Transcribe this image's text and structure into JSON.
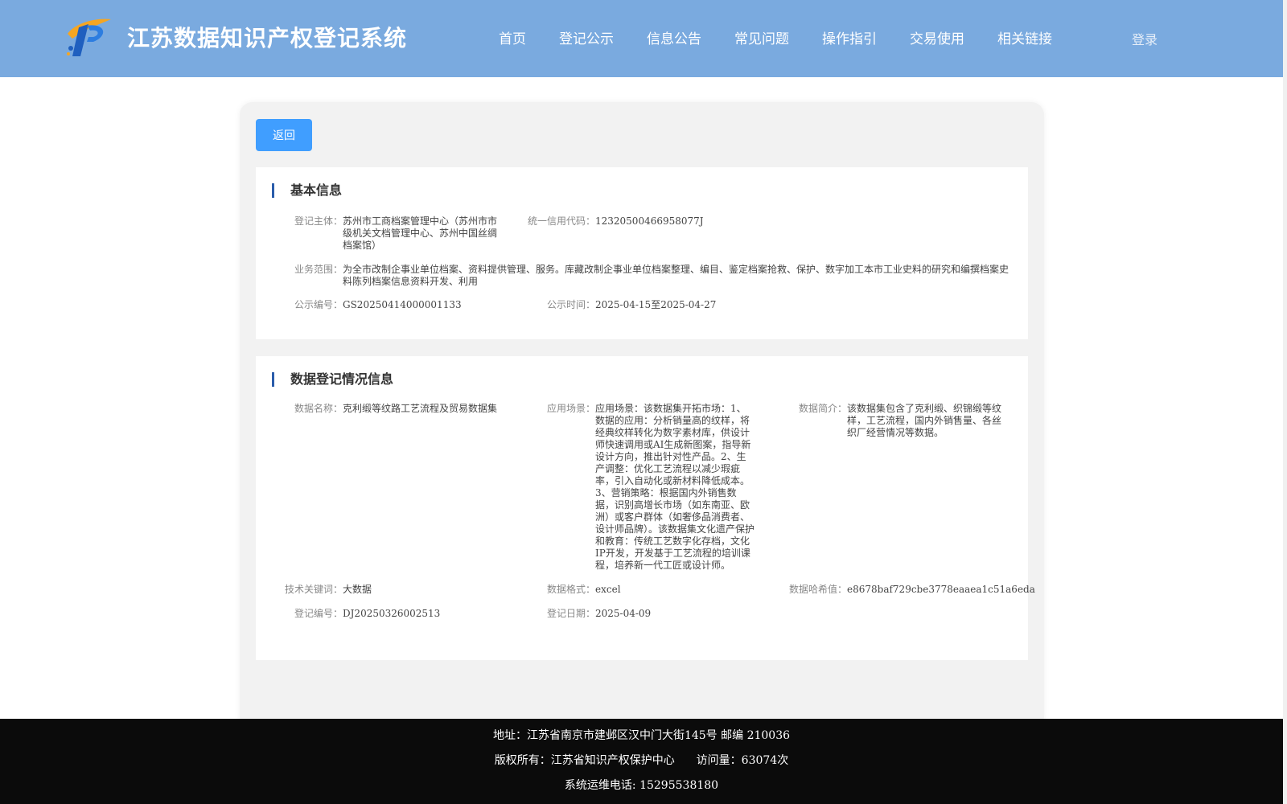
{
  "header": {
    "title": "江苏数据知识产权登记系统",
    "logo_icon": "logo-icon",
    "nav": [
      "首页",
      "登记公示",
      "信息公告",
      "常见问题",
      "操作指引",
      "交易使用",
      "相关链接"
    ],
    "login": "登录"
  },
  "back_label": "返回",
  "basic": {
    "title": "基本信息",
    "subject_label": "登记主体：",
    "subject": "苏州市工商档案管理中心（苏州市市级机关文档管理中心、苏州中国丝绸档案馆）",
    "credit_label": "统一信用代码：",
    "credit": "12320500466958077J",
    "scope_label": "业务范围：",
    "scope": "为全市改制企事业单位档案、资料提供管理、服务。库藏改制企事业单位档案整理、编目、鉴定档案抢救、保护、数字加工本市工业史料的研究和编撰档案史料陈列档案信息资料开发、利用",
    "notice_no_label": "公示编号：",
    "notice_no": "GS20250414000001133",
    "notice_time_label": "公示时间：",
    "notice_time": "2025-04-15至2025-04-27"
  },
  "reg": {
    "title": "数据登记情况信息",
    "name_label": "数据名称：",
    "name": "克利缎等纹路工艺流程及贸易数据集",
    "scene_label": "应用场景：",
    "scene": "应用场景：该数据集开拓市场：1、数据的应用：分析销量高的纹样，将经典纹样转化为数字素材库，供设计师快速调用或AI生成新图案，指导新设计方向，推出针对性产品。2、生产调整：优化工艺流程以减少瑕疵率，引入自动化或新材料降低成本。3、营销策略：根据国内外销售数据，识别高增长市场（如东南亚、欧洲）或客户群体（如奢侈品消费者、设计师品牌）。该数据集文化遗产保护和教育：传统工艺数字化存档，文化IP开发，开发基于工艺流程的培训课程，培养新一代工匠或设计师。",
    "intro_label": "数据简介：",
    "intro": "该数据集包含了克利缎、织锦缎等纹样，工艺流程，国内外销售量、各丝织厂经营情况等数据。",
    "keyword_label": "技术关键词：",
    "keyword": "大数据",
    "format_label": "数据格式：",
    "format": "excel",
    "hash_label": "数据哈希值：",
    "hash": "e8678baf729cbe3778eaaea1c51a6eda",
    "reg_no_label": "登记编号：",
    "reg_no": "DJ20250326002513",
    "reg_date_label": "登记日期：",
    "reg_date": "2025-04-09"
  },
  "footer": {
    "address": "地址：江苏省南京市建邺区汉中门大街145号 邮编 210036",
    "copyright": "版权所有：江苏省知识产权保护中心",
    "visits": "访问量：63074次",
    "phone": "系统运维电话: 15295538180"
  }
}
